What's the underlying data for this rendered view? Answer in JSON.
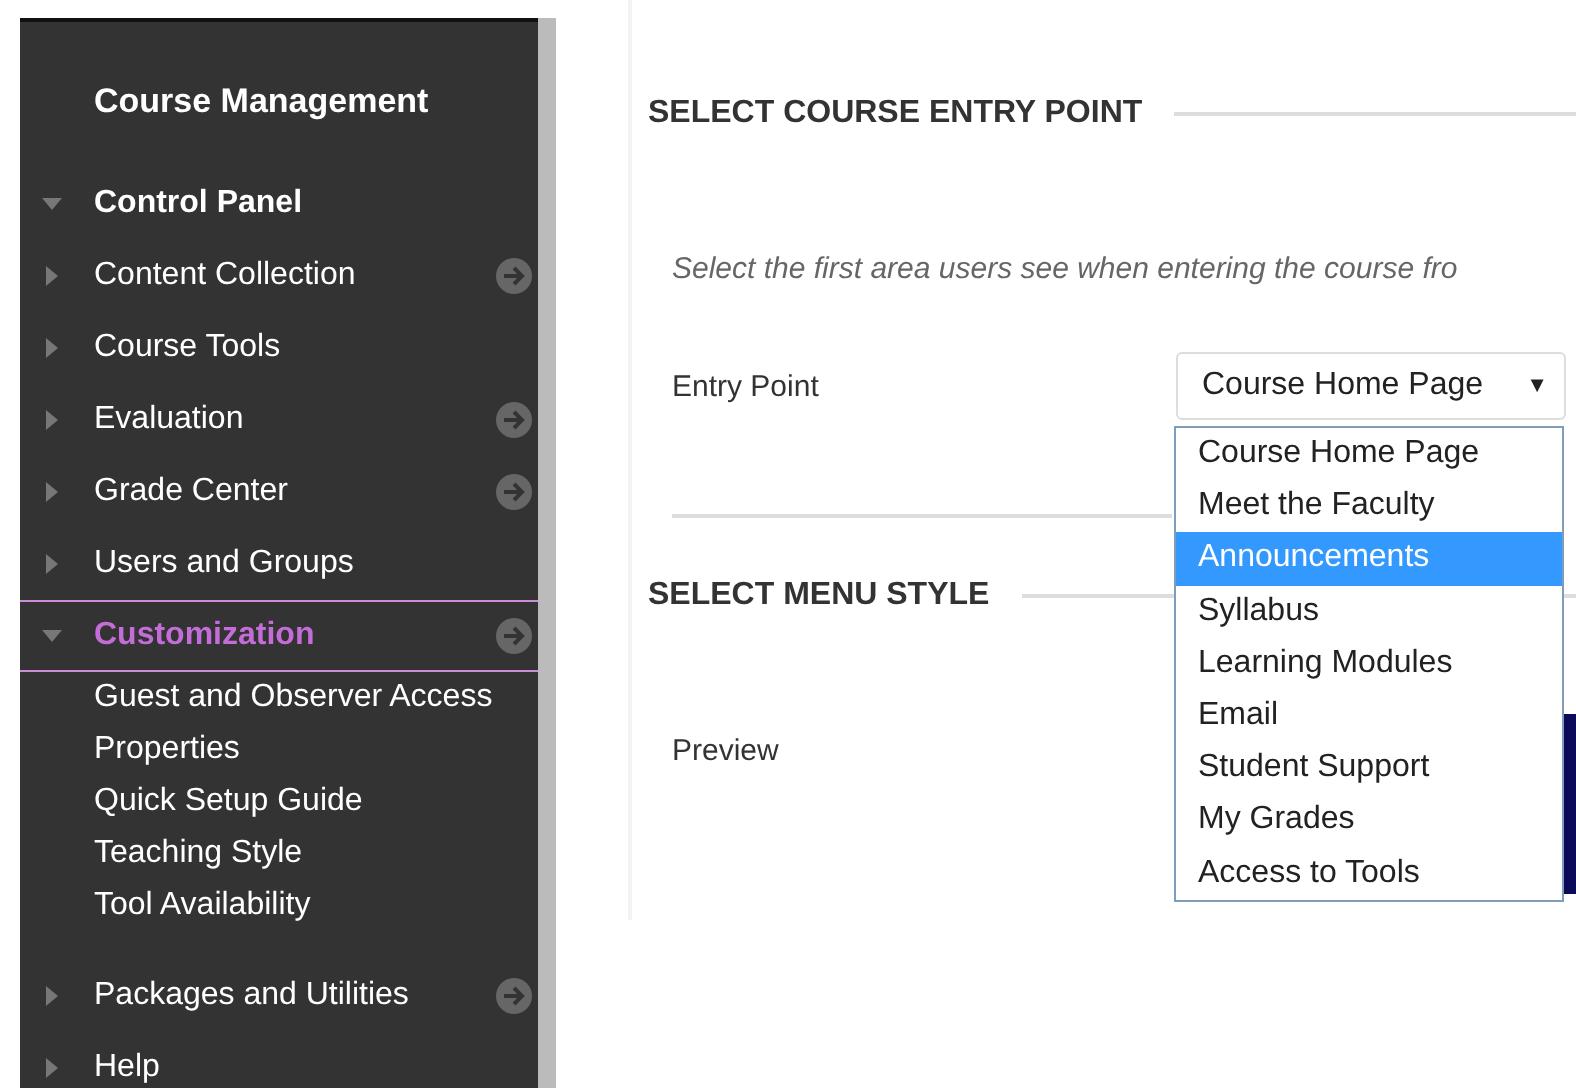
{
  "sidebar": {
    "title": "Course Management",
    "panel": {
      "label": "Control Panel",
      "expanded": true
    },
    "items": [
      {
        "label": "Content Collection",
        "expanded": false,
        "selected": false,
        "go": true
      },
      {
        "label": "Course Tools",
        "expanded": false,
        "selected": false,
        "go": false
      },
      {
        "label": "Evaluation",
        "expanded": false,
        "selected": false,
        "go": true
      },
      {
        "label": "Grade Center",
        "expanded": false,
        "selected": false,
        "go": true
      },
      {
        "label": "Users and Groups",
        "expanded": false,
        "selected": false,
        "go": false
      },
      {
        "label": "Customization",
        "expanded": true,
        "selected": true,
        "go": true,
        "children": [
          {
            "label": "Guest and Observer Access"
          },
          {
            "label": "Properties"
          },
          {
            "label": "Quick Setup Guide"
          },
          {
            "label": "Teaching Style"
          },
          {
            "label": "Tool Availability"
          }
        ]
      },
      {
        "label": "Packages and Utilities",
        "expanded": false,
        "selected": false,
        "go": true
      },
      {
        "label": "Help",
        "expanded": false,
        "selected": false,
        "go": false
      }
    ]
  },
  "main": {
    "entry_section": {
      "heading": "SELECT COURSE ENTRY POINT",
      "instructions": "Select the first area users see when entering the course fro",
      "field_label": "Entry Point",
      "value": "Course Home Page",
      "caret": "▼",
      "options": [
        {
          "label": "Course Home Page",
          "highlighted": false
        },
        {
          "label": "Meet the Faculty",
          "highlighted": false
        },
        {
          "label": "Announcements",
          "highlighted": true
        },
        {
          "label": "Syllabus",
          "highlighted": false
        },
        {
          "label": "Learning Modules",
          "highlighted": false
        },
        {
          "label": "Email",
          "highlighted": false
        },
        {
          "label": "Student Support",
          "highlighted": false
        },
        {
          "label": "My Grades",
          "highlighted": false
        },
        {
          "label": "Access to Tools",
          "highlighted": false
        }
      ]
    },
    "menu_section": {
      "heading": "SELECT MENU STYLE",
      "preview_label": "Preview"
    }
  }
}
